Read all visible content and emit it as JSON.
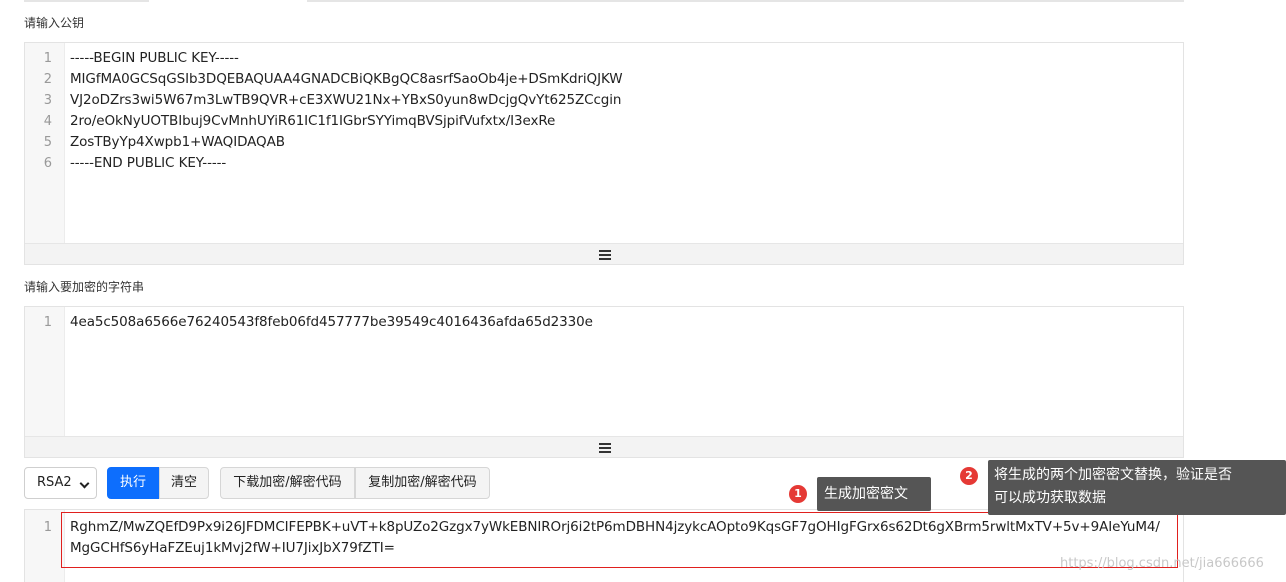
{
  "labels": {
    "public_key": "请输入公钥",
    "plaintext": "请输入要加密的字符串"
  },
  "public_key_editor": {
    "lines": [
      {
        "n": "1",
        "text": "-----BEGIN PUBLIC KEY-----"
      },
      {
        "n": "2",
        "text": "MIGfMA0GCSqGSIb3DQEBAQUAA4GNADCBiQKBgQC8asrfSaoOb4je+DSmKdriQJKW"
      },
      {
        "n": "3",
        "text": "VJ2oDZrs3wi5W67m3LwTB9QVR+cE3XWU21Nx+YBxS0yun8wDcjgQvYt625ZCcgin"
      },
      {
        "n": "4",
        "text": "2ro/eOkNyUOTBIbuj9CvMnhUYiR61IC1f1IGbrSYYimqBVSjpifVufxtx/I3exRe"
      },
      {
        "n": "5",
        "text": "ZosTByYp4Xwpb1+WAQIDAQAB"
      },
      {
        "n": "6",
        "text": "-----END PUBLIC KEY-----"
      }
    ]
  },
  "plaintext_editor": {
    "lines": [
      {
        "n": "1",
        "text": "4ea5c508a6566e76240543f8feb06fd457777be39549c4016436afda65d2330e"
      }
    ]
  },
  "toolbar": {
    "algorithm": "RSA2",
    "execute_label": "执行",
    "clear_label": "清空",
    "download_label": "下载加密/解密代码",
    "copy_label": "复制加密/解密代码"
  },
  "result_editor": {
    "lines": [
      {
        "n": "1",
        "text": "RghmZ/MwZQEfD9Px9i26JFDMCIFEPBK+uVT+k8pUZo2Gzgx7yWkEBNIROrj6i2tP6mDBHN4jzykcAOpto9KqsGF7gOHIgFGrx6s62Dt6gXBrm5rwltMxTV+5v+9AIeYuM4/"
      },
      {
        "n": "",
        "text": "MgGCHfS6yHaFZEuj1kMvj2fW+IU7JixJbX79fZTI="
      }
    ]
  },
  "annotations": {
    "a1": {
      "badge": "1",
      "text": "生成加密密文"
    },
    "a2": {
      "badge": "2",
      "line1": "将生成的两个加密密文替换，验证是否",
      "line2": "可以成功获取数据"
    }
  },
  "watermark": "https://blog.csdn.net/jia666666",
  "colors": {
    "primary": "#0d6efd",
    "highlight_border": "#e0201e",
    "badge": "#e53935",
    "tooltip": "#555555"
  }
}
